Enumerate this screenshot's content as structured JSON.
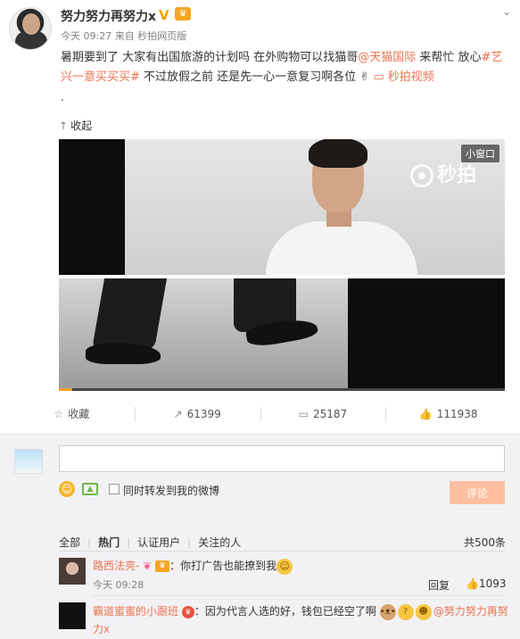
{
  "post": {
    "username": "努力努力再努力x",
    "vip_badge": "V",
    "meta": "今天 09:27 来自 秒拍网页版",
    "text_before_mention": "暑期要到了 大家有出国旅游的计划吗 在外购物可以找猫哥",
    "mention": "@天猫国际",
    "text_mid": " 来帮忙 放心",
    "hashtag": "#艺兴一意买买买#",
    "text_after": " 不过放假之前 还是先一心一意复习啊各位",
    "video_link": "秒拍视频",
    "trailing": ".",
    "collapse_label": "收起"
  },
  "video": {
    "mini_window_label": "小窗口",
    "watermark": "秒拍",
    "progress_fraction": 0.03
  },
  "actions": {
    "favorite": "收藏",
    "repost_count": "61399",
    "comment_count": "25187",
    "like_count": "111938"
  },
  "comment_box": {
    "input_value": "",
    "also_repost_label": "同时转发到我的微博",
    "submit_label": "评论"
  },
  "filters": {
    "all": "全部",
    "hot": "热门",
    "verified": "认证用户",
    "following": "关注的人",
    "total": "共500条"
  },
  "comments": [
    {
      "name": "路西法亮-",
      "text": "：你打广告也能撩到我",
      "time": "今天 09:28",
      "reply": "回复",
      "likes": "1093"
    },
    {
      "name": "霸道蜜蜜的小跟班",
      "text": "：因为代言人选的好，钱包已经空了啊",
      "mention": "@努力努力再努力x"
    }
  ],
  "colors": {
    "accent": "#eb7350",
    "submit_bg": "#ffc09f",
    "progress": "#f6a01a"
  }
}
